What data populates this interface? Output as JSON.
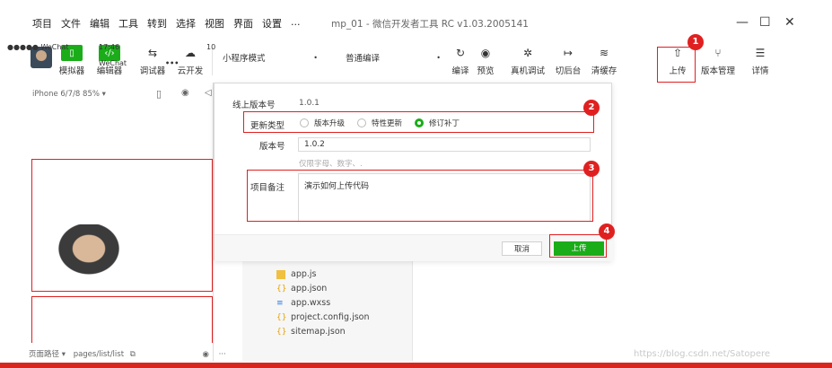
{
  "menu": [
    "项目",
    "文件",
    "编辑",
    "工具",
    "转到",
    "选择",
    "视图",
    "界面",
    "设置",
    "..."
  ],
  "window_title": "mp_01 - 微信开发者工具 RC v1.03.2005141",
  "window_controls": {
    "minimize": "—",
    "maximize": "☐",
    "close": "✕"
  },
  "toolbar": {
    "simulator": "模拟器",
    "editor": "编辑器",
    "debugger": "调试器",
    "cloud": "云开发",
    "mode_select": "小程序模式",
    "compile_select": "普通编译",
    "compile": "编译",
    "preview": "预览",
    "real_debug": "真机调试",
    "background": "切后台",
    "clear_cache": "清缓存",
    "upload": "上传",
    "version_mgmt": "版本管理",
    "details": "详情"
  },
  "simulator": {
    "device": "iPhone 6/7/8 85% ▾",
    "status_signal": "●●●●● WeChat",
    "status_time": "17:46",
    "status_right": "10",
    "page_title": "WeChat",
    "menu_dots": "•••",
    "page_path_label": "页面路径 ▾",
    "page_path": "pages/list/list"
  },
  "files": [
    {
      "name": "app.js",
      "icon": "js"
    },
    {
      "name": "app.json",
      "icon": "json"
    },
    {
      "name": "app.wxss",
      "icon": "wxss"
    },
    {
      "name": "project.config.json",
      "icon": "json"
    },
    {
      "name": "sitemap.json",
      "icon": "json"
    }
  ],
  "modal": {
    "online_version_label": "线上版本号",
    "online_version_value": "1.0.1",
    "update_type_label": "更新类型",
    "update_types": [
      "版本升级",
      "特性更新",
      "修订补丁"
    ],
    "selected_update_type": "修订补丁",
    "version_label": "版本号",
    "version_value": "1.0.2",
    "version_hint": "仅限字母、数字、.",
    "remark_label": "项目备注",
    "remark_value": "演示如何上传代码",
    "cancel": "取消",
    "upload": "上传"
  },
  "badges": [
    "1",
    "2",
    "3",
    "4"
  ],
  "watermark": "https://blog.csdn.net/Satopere",
  "colors": {
    "green": "#1aad19",
    "red": "#e02020"
  }
}
